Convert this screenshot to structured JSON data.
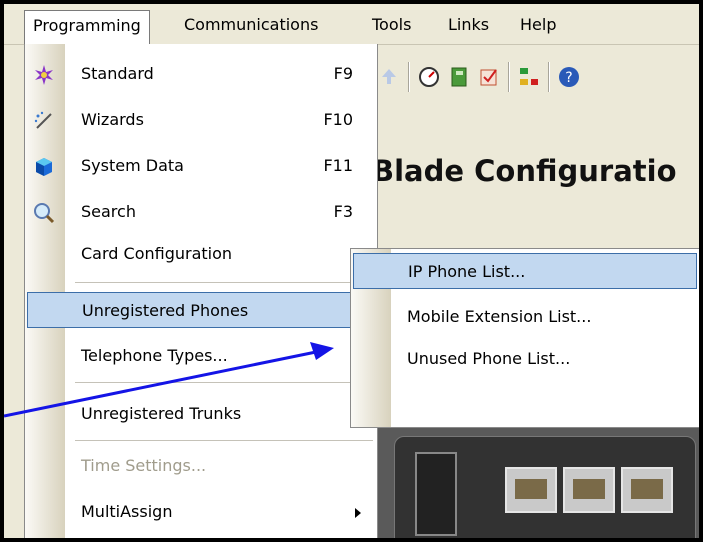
{
  "menubar": {
    "items": [
      "Programming",
      "Communications",
      "Tools",
      "Links",
      "Help"
    ]
  },
  "background": {
    "title": "Blade Configuratio"
  },
  "programming_menu": {
    "items": [
      {
        "label": "Standard",
        "shortcut": "F9",
        "icon": "star-gear-icon"
      },
      {
        "label": "Wizards",
        "shortcut": "F10",
        "icon": "magic-wand-icon"
      },
      {
        "label": "System Data",
        "shortcut": "F11",
        "icon": "blue-cube-icon"
      },
      {
        "label": "Search",
        "shortcut": "F3",
        "icon": "magnifier-icon"
      },
      {
        "label": "Card Configuration"
      },
      {
        "label": "Unregistered Phones",
        "submenu": true,
        "highlighted": true
      },
      {
        "label": "Telephone Types..."
      },
      {
        "label": "Unregistered Trunks",
        "submenu": true
      },
      {
        "label": "Time Settings...",
        "disabled": true
      },
      {
        "label": "MultiAssign",
        "submenu": true
      }
    ]
  },
  "unregistered_phones_submenu": {
    "items": [
      {
        "label": "IP Phone List...",
        "highlighted": true
      },
      {
        "label": "Mobile Extension List..."
      },
      {
        "label": "Unused Phone List..."
      }
    ]
  },
  "colors": {
    "highlight": "#c2d8f0",
    "highlight_border": "#3c6ea8",
    "annotation_arrow": "#1414e6"
  }
}
